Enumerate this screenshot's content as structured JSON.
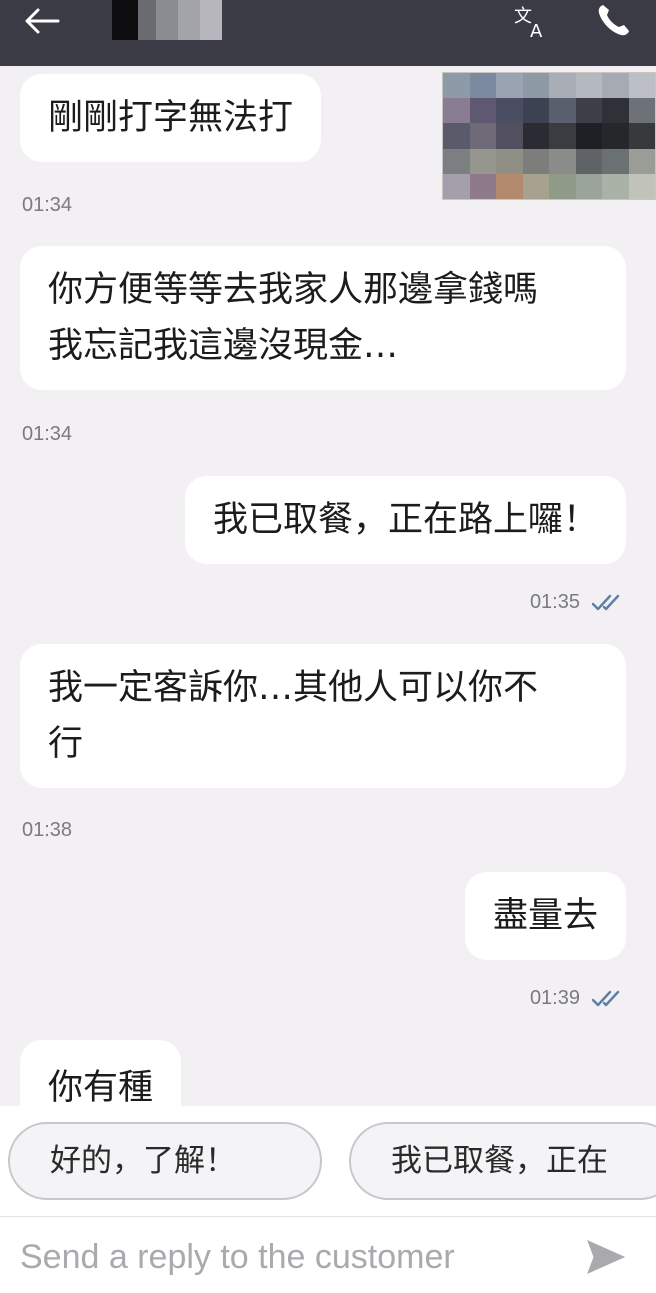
{
  "header": {
    "icons": {
      "back": "arrow-left-icon",
      "translate": "translate-icon",
      "call": "phone-icon"
    },
    "colors": {
      "bar": "#3a3b45",
      "icon": "#ffffff"
    }
  },
  "messages": [
    {
      "direction": "in",
      "lines": [
        "剛剛打字無法打"
      ],
      "time": "01:34"
    },
    {
      "direction": "in",
      "lines": [
        "你方便等等去我家人那邊拿錢嗎",
        "我忘記我這邊沒現金…"
      ],
      "time": "01:34"
    },
    {
      "direction": "out",
      "lines": [
        "我已取餐，正在路上囉！"
      ],
      "time": "01:35",
      "read": true
    },
    {
      "direction": "in",
      "lines": [
        "我一定客訴你…其他人可以你不",
        "行"
      ],
      "time": "01:38"
    },
    {
      "direction": "out",
      "lines": [
        "盡量去"
      ],
      "time": "01:39",
      "read": true
    },
    {
      "direction": "in",
      "lines": [
        "你有種"
      ],
      "time": ""
    }
  ],
  "quick_replies": [
    "好的，了解！",
    "我已取餐，正在"
  ],
  "composer": {
    "placeholder": "Send a reply to the customer",
    "send_icon": "send-icon"
  },
  "colors": {
    "background": "#f2f0f3",
    "bubble": "#ffffff",
    "timestamp": "#7a7a80",
    "read_tick": "#5b7fa6"
  }
}
